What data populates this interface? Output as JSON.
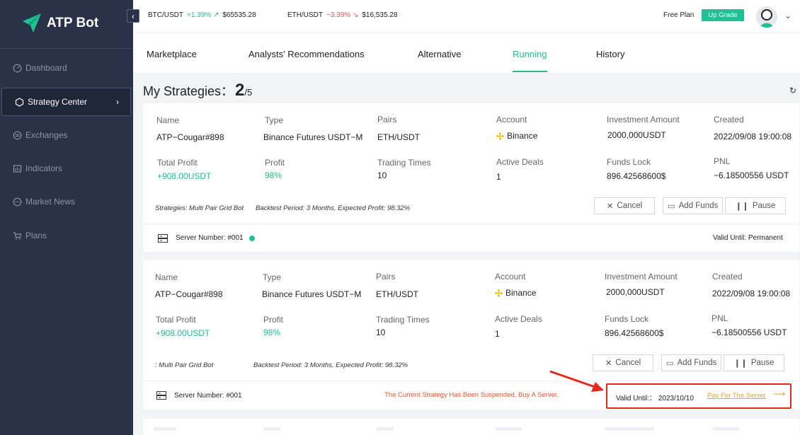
{
  "app": {
    "name": "ATP Bot"
  },
  "sidebar": {
    "items": [
      {
        "label": "Dashboard",
        "icon": "dashboard-icon"
      },
      {
        "label": "Strategy Center",
        "icon": "cube-icon",
        "active": true
      },
      {
        "label": "Exchanges",
        "icon": "exchange-icon"
      },
      {
        "label": "Indicators",
        "icon": "indicator-icon"
      },
      {
        "label": "Market News",
        "icon": "chat-icon"
      },
      {
        "label": "Plans",
        "icon": "cart-icon"
      }
    ]
  },
  "topbar": {
    "tickers": [
      {
        "pair": "BTC/USDT",
        "change": "+1.39%",
        "direction": "up",
        "price": "$65535.28"
      },
      {
        "pair": "ETH/USDT",
        "change": "−3.39%",
        "direction": "down",
        "price": "$16,535.28"
      }
    ],
    "plan": "Free Plan",
    "upgrade": "Up Grade"
  },
  "tabs": [
    "Marketplace",
    "Analysts' Recommendations",
    "Alternative",
    "Running",
    "History"
  ],
  "active_tab": "Running",
  "page": {
    "title": "My Strategies：",
    "count": "2",
    "total": "/5"
  },
  "labels": {
    "name": "Name",
    "type": "Type",
    "pairs": "Pairs",
    "account": "Account",
    "investment": "Investment Amount",
    "created": "Created",
    "total_profit": "Total Profit",
    "profit": "Profit",
    "trading_times": "Trading Times",
    "active_deals": "Active Deals",
    "funds_lock": "Funds Lock",
    "pnl": "PNL"
  },
  "buttons": {
    "cancel": "Cancel",
    "add_funds": "Add Funds",
    "pause": "Pause"
  },
  "strategies": [
    {
      "name": "ATP−Cougar#898",
      "type": "Binance Futures USDT−M",
      "pair": "ETH/USDT",
      "account": "Binance",
      "investment": "2000,000USDT",
      "created": "2022/09/08 19:00:08",
      "total_profit": "+908.00USDT",
      "profit": "98%",
      "trading_times": "10",
      "active_deals": "1",
      "funds_lock": "896.42568600$",
      "pnl": "−6.18500556 USDT",
      "meta_strategy": "Strategies: Multi Pair Grid Bot",
      "meta_backtest": "Backtest Period: 3 Months, Expected Profit: 98.32%",
      "server": "Server Number: #001",
      "valid": "Valid Until: Permanent"
    },
    {
      "name": "ATP−Cougar#898",
      "type": "Binance Futures USDT−M",
      "pair": "ETH/USDT",
      "account": "Binance",
      "investment": "2000,000USDT",
      "created": "2022/09/08 19:00:08",
      "total_profit": "+908.00USDT",
      "profit": "98%",
      "trading_times": "10",
      "active_deals": "1",
      "funds_lock": "896.42568600$",
      "pnl": "−6.18500556 USDT",
      "meta_strategy": ": Multi Pair Grid Bot",
      "meta_backtest": "Backtest Period: 3 Months, Expected Profit: 98.32%",
      "server": "Server Number: #001",
      "notice": "The Current Strategy Has Been Suspended, Buy A Server.",
      "valid": "Valid Until:： 2023/10/10",
      "pay": "Pay For The Server"
    }
  ],
  "colors": {
    "accent": "#1fbf8f",
    "sidebar": "#2a3249",
    "warning": "#e8572a",
    "highlight": "#e5281e",
    "link": "#e5a520"
  }
}
